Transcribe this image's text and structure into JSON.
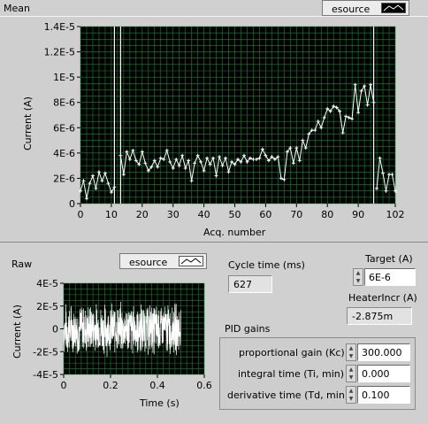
{
  "mean": {
    "title": "Mean",
    "legend_label": "esource",
    "chart_data": {
      "type": "line",
      "xlabel": "Acq. number",
      "ylabel": "Current (A)",
      "xlim": [
        0,
        102
      ],
      "ylim": [
        0,
        1.4e-05
      ],
      "x_ticks": [
        "0",
        "10",
        "20",
        "30",
        "40",
        "50",
        "60",
        "70",
        "80",
        "90",
        "102"
      ],
      "y_ticks": [
        "0",
        "2E-6",
        "4E-6",
        "6E-6",
        "8E-6",
        "1E-5",
        "1.2E-5",
        "1.4E-5"
      ],
      "grid": true,
      "x": [
        0,
        1,
        2,
        3,
        4,
        5,
        6,
        7,
        8,
        9,
        10,
        11,
        13,
        14,
        15,
        16,
        17,
        18,
        19,
        20,
        21,
        22,
        23,
        24,
        25,
        26,
        27,
        28,
        29,
        30,
        31,
        32,
        33,
        34,
        35,
        36,
        37,
        38,
        39,
        40,
        41,
        42,
        43,
        44,
        45,
        46,
        47,
        48,
        49,
        50,
        51,
        52,
        53,
        54,
        55,
        56,
        57,
        58,
        59,
        60,
        61,
        62,
        63,
        64,
        65,
        66,
        67,
        68,
        69,
        70,
        71,
        72,
        73,
        74,
        75,
        76,
        77,
        78,
        79,
        80,
        81,
        82,
        83,
        84,
        85,
        86,
        87,
        88,
        89,
        90,
        91,
        92,
        93,
        94,
        95,
        96,
        97,
        98,
        99,
        100,
        101,
        102
      ],
      "values": [
        1e-06,
        1.8e-06,
        4e-07,
        1.6e-06,
        2.2e-06,
        1.2e-06,
        2.5e-06,
        1.8e-06,
        2.4e-06,
        1.6e-06,
        9e-07,
        1.3e-06,
        3.8e-06,
        2.3e-06,
        4.1e-06,
        3.5e-06,
        4.2e-06,
        3.4e-06,
        3.1e-06,
        4.1e-06,
        3.2e-06,
        2.6e-06,
        2.9e-06,
        3.4e-06,
        2.9e-06,
        3.6e-06,
        3.5e-06,
        4.2e-06,
        3.3e-06,
        2.8e-06,
        3.5e-06,
        3e-06,
        3.8e-06,
        2.8e-06,
        3.4e-06,
        1.8e-06,
        3.2e-06,
        3.8e-06,
        3.3e-06,
        2.6e-06,
        3.6e-06,
        3.1e-06,
        3.6e-06,
        2.2e-06,
        3.7e-06,
        3e-06,
        3.6e-06,
        2.5e-06,
        3.3e-06,
        3.1e-06,
        3.5e-06,
        3.3e-06,
        3.8e-06,
        3.3e-06,
        3.6e-06,
        3.5e-06,
        3.5e-06,
        3.6e-06,
        4.3e-06,
        3.8e-06,
        3.4e-06,
        3.7e-06,
        3.5e-06,
        3.7e-06,
        2e-06,
        1.9e-06,
        4.1e-06,
        4.4e-06,
        3.2e-06,
        4.4e-06,
        3.4e-06,
        5e-06,
        4.4e-06,
        5.5e-06,
        5.8e-06,
        5.8e-06,
        6.5e-06,
        6e-06,
        6.8e-06,
        7.5e-06,
        7.3e-06,
        7.7e-06,
        7.6e-06,
        7.3e-06,
        5.6e-06,
        6.9e-06,
        6.8e-06,
        6.7e-06,
        9.4e-06,
        7.2e-06,
        8.9e-06,
        9.3e-06,
        7.8e-06,
        9.4e-06,
        8e-06,
        1.2e-06,
        3.6e-06,
        2.4e-06,
        1e-06,
        2.3e-06,
        2.3e-06,
        1e-06
      ],
      "vertical_markers": [
        11,
        13,
        95
      ]
    }
  },
  "raw": {
    "title": "Raw",
    "legend_label": "esource",
    "chart_data": {
      "type": "line",
      "xlabel": "Time (s)",
      "ylabel": "Current (A)",
      "xlim": [
        0,
        0.6
      ],
      "ylim": [
        -4e-05,
        4e-05
      ],
      "x_ticks": [
        "0",
        "0.2",
        "0.4",
        "0.6"
      ],
      "y_ticks": [
        "4E-5",
        "2E-5",
        "0",
        "-2E-5",
        "-4E-5"
      ],
      "grid": true,
      "signal_range": [
        0,
        0.5
      ],
      "amplitude": 2.5e-05
    }
  },
  "cycle": {
    "label": "Cycle time (ms)",
    "value": "627"
  },
  "target": {
    "label": "Target (A)",
    "value": "6E-6"
  },
  "heater": {
    "label": "HeaterIncr (A)",
    "value": "-2.875m"
  },
  "pid": {
    "title": "PID gains",
    "kc_label": "proportional gain (Kc)",
    "kc_value": "300.000",
    "ti_label": "integral time (Ti, min)",
    "ti_value": "0.000",
    "td_label": "derivative time (Td, min)",
    "td_value": "0.100"
  },
  "colors": {
    "plot_bg": "#000000",
    "grid": "#0f8a2f",
    "trace": "#ffffff",
    "panel": "#d0d0d0"
  }
}
